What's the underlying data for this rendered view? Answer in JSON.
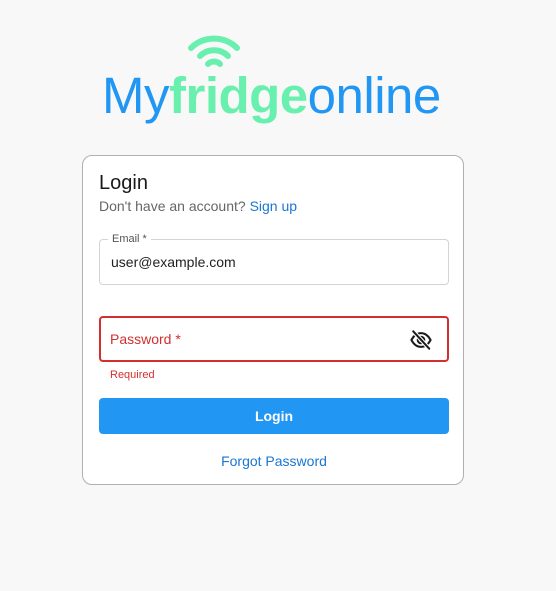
{
  "logo": {
    "part1": "My",
    "part2": "fridge",
    "part3": "online"
  },
  "login_card": {
    "title": "Login",
    "signup_prompt": "Don't have an account?",
    "signup_link": "Sign up",
    "email": {
      "label": "Email *",
      "value": "user@example.com"
    },
    "password": {
      "placeholder": "Password *",
      "error": "Required"
    },
    "login_button": "Login",
    "forgot_password": "Forgot Password"
  },
  "icons": {
    "wifi": "wifi-icon",
    "visibility_off": "eye-off-icon"
  },
  "colors": {
    "brand_blue": "#2196f3",
    "brand_green": "#69f0ae",
    "link": "#1976d2",
    "error": "#d32f2f"
  }
}
